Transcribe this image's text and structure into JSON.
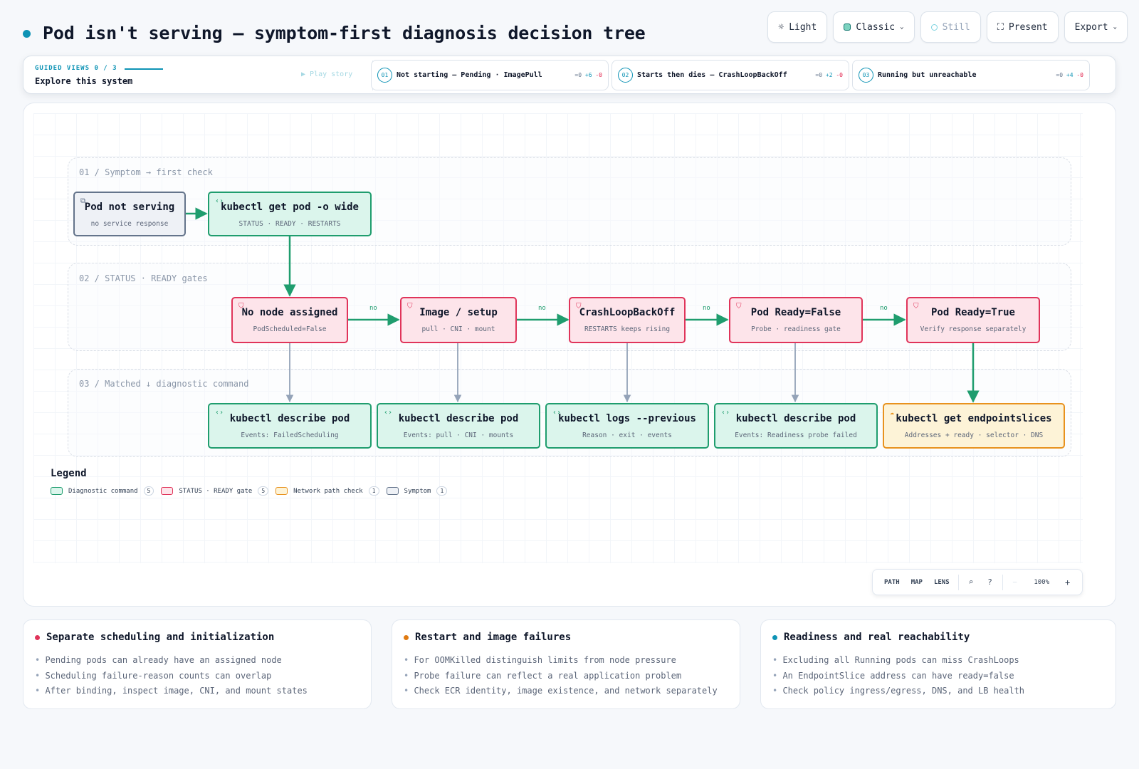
{
  "header": {
    "title": "Pod isn't serving — symptom-first diagnosis decision tree",
    "accent": "#0e93b5"
  },
  "toolbar": {
    "light_label": "Light",
    "classic_label": "Classic",
    "still_label": "Still",
    "present_label": "Present",
    "export_label": "Export"
  },
  "guided": {
    "kicker": "GUIDED VIEWS 0 / 3",
    "title": "Explore this system",
    "play_label": "▶ Play story",
    "steps": [
      {
        "num": "01",
        "label": "Not starting — Pending · ImagePull",
        "eq": "=0",
        "plus": "+6",
        "minus": "-0"
      },
      {
        "num": "02",
        "label": "Starts then dies — CrashLoopBackOff",
        "eq": "=0",
        "plus": "+2",
        "minus": "-0"
      },
      {
        "num": "03",
        "label": "Running but unreachable",
        "eq": "=0",
        "plus": "+4",
        "minus": "-0"
      }
    ]
  },
  "lanes": [
    {
      "label": "01 / Symptom → first check"
    },
    {
      "label": "02 / STATUS · READY gates"
    },
    {
      "label": "03 / Matched ↓ diagnostic command"
    }
  ],
  "nodes": {
    "symptom": {
      "title": "Pod not serving",
      "sub": "no service response"
    },
    "getpod": {
      "title": "kubectl get pod -o wide",
      "sub": "STATUS · READY · RESTARTS"
    },
    "nonode": {
      "title": "No node assigned",
      "sub": "PodScheduled=False"
    },
    "image": {
      "title": "Image / setup",
      "sub": "pull · CNI · mount"
    },
    "crash": {
      "title": "CrashLoopBackOff",
      "sub": "RESTARTS keeps rising"
    },
    "readyfalse": {
      "title": "Pod Ready=False",
      "sub": "Probe · readiness gate"
    },
    "readytrue": {
      "title": "Pod Ready=True",
      "sub": "Verify response separately"
    },
    "describe1": {
      "title": "kubectl describe pod",
      "sub": "Events: FailedScheduling"
    },
    "describe2": {
      "title": "kubectl describe pod",
      "sub": "Events: pull · CNI · mounts"
    },
    "logs": {
      "title": "kubectl logs --previous",
      "sub": "Reason · exit · events"
    },
    "describe3": {
      "title": "kubectl describe pod",
      "sub": "Events: Readiness probe failed"
    },
    "endpoints": {
      "title": "kubectl get endpointslices",
      "sub": "Addresses + ready · selector · DNS"
    }
  },
  "edge_labels": [
    "no",
    "no",
    "no",
    "no"
  ],
  "legend": {
    "title": "Legend",
    "items": [
      {
        "label": "Diagnostic command",
        "count": "5",
        "fill": "#dbf5ec",
        "stroke": "#1f9d6e"
      },
      {
        "label": "STATUS · READY gate",
        "count": "5",
        "fill": "#fde4ea",
        "stroke": "#e0345a"
      },
      {
        "label": "Network path check",
        "count": "1",
        "fill": "#fdf3d7",
        "stroke": "#e8921e"
      },
      {
        "label": "Symptom",
        "count": "1",
        "fill": "#eef1f6",
        "stroke": "#64748b"
      }
    ]
  },
  "zoom": {
    "path_label": "PATH",
    "map_label": "MAP",
    "lens_label": "LENS",
    "level": "100%"
  },
  "cards": [
    {
      "title": "Separate scheduling and initialization",
      "dot": "#e0345a",
      "items": [
        "Pending pods can already have an assigned node",
        "Scheduling failure-reason counts can overlap",
        "After binding, inspect image, CNI, and mount states"
      ]
    },
    {
      "title": "Restart and image failures",
      "dot": "#e07a12",
      "items": [
        "For OOMKilled distinguish limits from node pressure",
        "Probe failure can reflect a real application problem",
        "Check ECR identity, image existence, and network separately"
      ]
    },
    {
      "title": "Readiness and real reachability",
      "dot": "#0e93b5",
      "items": [
        "Excluding all Running pods can miss CrashLoops",
        "An EndpointSlice address can have ready=false",
        "Check policy ingress/egress, DNS, and LB health"
      ]
    }
  ]
}
